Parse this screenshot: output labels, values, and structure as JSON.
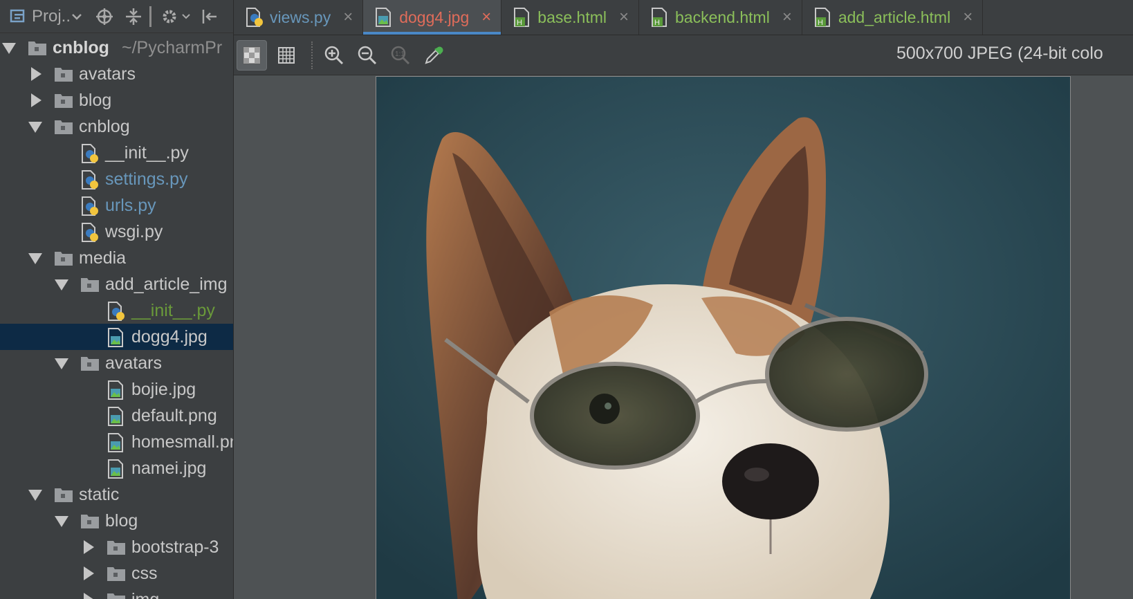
{
  "project_panel": {
    "toolbar": {
      "title": "Proj..",
      "icons": [
        "project-view-icon",
        "dropdown-icon",
        "locate-icon",
        "collapse-all-icon",
        "gear-icon",
        "hide-icon"
      ]
    },
    "tree": [
      {
        "label": "cnblog",
        "suffix": "~/PycharmPr",
        "type": "folder",
        "expanded": true
      },
      {
        "label": "avatars",
        "type": "folder",
        "expanded": false
      },
      {
        "label": "blog",
        "type": "folder",
        "expanded": false
      },
      {
        "label": "cnblog",
        "type": "folder",
        "expanded": true
      },
      {
        "label": "__init__.py",
        "type": "python"
      },
      {
        "label": "settings.py",
        "type": "python"
      },
      {
        "label": "urls.py",
        "type": "python"
      },
      {
        "label": "wsgi.py",
        "type": "python"
      },
      {
        "label": "media",
        "type": "folder",
        "expanded": true
      },
      {
        "label": "add_article_img",
        "type": "folder",
        "expanded": true
      },
      {
        "label": "__init__.py",
        "type": "python"
      },
      {
        "label": "dogg4.jpg",
        "type": "image",
        "selected": true
      },
      {
        "label": "avatars",
        "type": "folder",
        "expanded": true
      },
      {
        "label": "bojie.jpg",
        "type": "image"
      },
      {
        "label": "default.png",
        "type": "image"
      },
      {
        "label": "homesmall.png",
        "type": "image"
      },
      {
        "label": "namei.jpg",
        "type": "image"
      },
      {
        "label": "static",
        "type": "folder",
        "expanded": true
      },
      {
        "label": "blog",
        "type": "folder",
        "expanded": true
      },
      {
        "label": "bootstrap-3",
        "type": "folder",
        "expanded": false
      },
      {
        "label": "css",
        "type": "folder",
        "expanded": false
      },
      {
        "label": "img",
        "type": "folder",
        "expanded": false
      }
    ]
  },
  "editor": {
    "tabs": [
      {
        "label": "views.py",
        "type": "python",
        "color": "#6897bb"
      },
      {
        "label": "dogg4.jpg",
        "type": "image",
        "active": true,
        "color": "#e06c5a"
      },
      {
        "label": "base.html",
        "type": "html",
        "color": "#8bbf5a"
      },
      {
        "label": "backend.html",
        "type": "html",
        "color": "#8bbf5a"
      },
      {
        "label": "add_article.html",
        "type": "html",
        "color": "#8bbf5a"
      }
    ],
    "close_glyph": "×",
    "image_toolbar": {
      "icons": [
        "chessboard-icon",
        "grid-icon",
        "zoom-in-icon",
        "zoom-out-icon",
        "actual-size-icon",
        "color-picker-icon"
      ],
      "info": "500x700 JPEG (24-bit colo"
    },
    "image": {
      "subject": "dog-with-sunglasses",
      "background_color": "#2c4a55"
    }
  },
  "colors": {
    "panel_bg": "#3c3f41",
    "editor_bg": "#4e5254",
    "selection": "#0d2a45",
    "accent": "#4a88c7"
  }
}
